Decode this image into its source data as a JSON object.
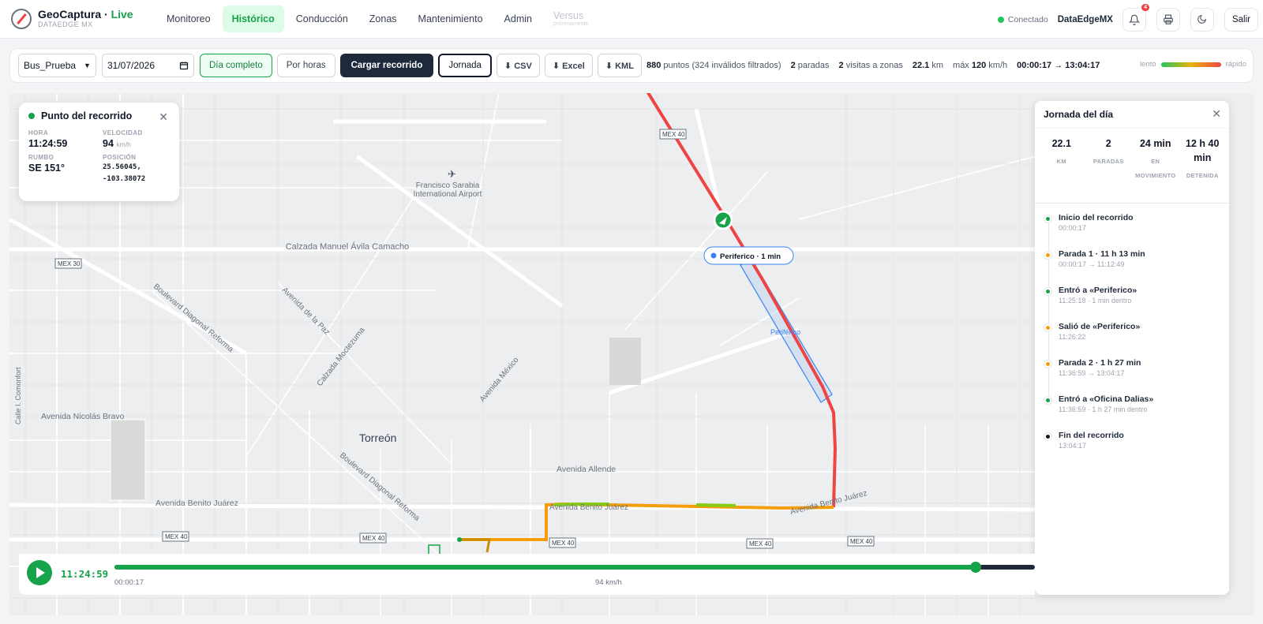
{
  "app": {
    "name": "GeoCaptura",
    "live": "Live",
    "sub": "DATAEDGE MX"
  },
  "nav": [
    {
      "label": "Monitoreo"
    },
    {
      "label": "Histórico"
    },
    {
      "label": "Conducción"
    },
    {
      "label": "Zonas"
    },
    {
      "label": "Mantenimiento"
    },
    {
      "label": "Admin"
    },
    {
      "label": "Versus",
      "sub": "próximamente"
    }
  ],
  "header": {
    "status": "Conectado",
    "org": "DataEdgeMX",
    "notifications": "4",
    "logout": "Salir",
    "icons": [
      "bell-icon",
      "printer-icon",
      "moon-icon"
    ]
  },
  "toolbar": {
    "vehicle": "Bus_Prueba",
    "date": "31/07/2026",
    "full_day": "Día completo",
    "by_hours": "Por horas",
    "load": "Cargar recorrido",
    "jornada": "Jornada",
    "csv": "⬇ CSV",
    "excel": "⬇ Excel",
    "kml": "⬇ KML",
    "points_num": "880",
    "points_text": "puntos (324 inválidos filtrados)",
    "stops_num": "2",
    "stops_text": "paradas",
    "visits_num": "2",
    "visits_text": "visitas a zonas",
    "km_num": "22.1",
    "km_text": "km",
    "max_text": "máx",
    "max_num": "120",
    "max_unit": "km/h",
    "range": "00:00:17 → 13:04:17",
    "legend_slow": "lento",
    "legend_fast": "rápido"
  },
  "map": {
    "labels": {
      "airport": "Francisco Sarabia",
      "airport2": "International Airport",
      "calzada": "Calzada Manuel Ávila Camacho",
      "diagonal": "Boulevard Diagonal Reforma",
      "diagonal2": "Boulevard Diagonal Reforma",
      "paz": "Avenida de la Paz",
      "moctezuma": "Calzada Moctezuma",
      "mexico": "Avenida México",
      "bravo": "Avenida Nicolás Bravo",
      "comonfort": "Calle I. Comonfort",
      "torreon": "Torreón",
      "allende": "Avenida Allende",
      "juarez": "Avenida Benito Juárez",
      "juarez2": "Avenida Benito Juárez",
      "juarez3": "Avenida Benito Juárez",
      "periferico": "Periférico",
      "mex40a": "MEX 40",
      "mex40b": "MEX 40",
      "mex40c": "MEX 40",
      "mex40d": "MEX 40",
      "mex40e": "MEX 40",
      "mex40f": "MEX 40",
      "mex30": "MEX 30"
    },
    "zone_tooltip": "Periferico · 1 min"
  },
  "point": {
    "title": "Punto del recorrido",
    "hora_label": "HORA",
    "hora": "11:24:59",
    "vel_label": "VELOCIDAD",
    "vel": "94",
    "vel_unit": "km/h",
    "rumbo_label": "RUMBO",
    "rumbo": "SE 151°",
    "pos_label": "POSICIÓN",
    "lat": "25.56045,",
    "lon": "-103.38072"
  },
  "jornada": {
    "title": "Jornada del día",
    "stats": [
      {
        "value": "22.1",
        "label": "KM"
      },
      {
        "value": "2",
        "label": "PARADAS"
      },
      {
        "value": "24 min",
        "label": "EN MOVIMIENTO"
      },
      {
        "value": "12 h 40 min",
        "label": "DETENIDA"
      }
    ],
    "events": [
      {
        "title": "Inicio del recorrido",
        "sub": "00:00:17",
        "color": "#16a34a"
      },
      {
        "title": "Parada 1 · 11 h 13 min",
        "sub": "00:00:17 → 11:12:49",
        "color": "#f59e0b"
      },
      {
        "title": "Entró a «Periferico»",
        "sub": "11:25:18 · 1 min dentro",
        "color": "#16a34a"
      },
      {
        "title": "Salió de «Periferico»",
        "sub": "11:26:22",
        "color": "#f59e0b"
      },
      {
        "title": "Parada 2 · 1 h 27 min",
        "sub": "11:36:59 → 13:04:17",
        "color": "#f59e0b"
      },
      {
        "title": "Entró a «Oficina Dalias»",
        "sub": "11:36:59 · 1 h 27 min dentro",
        "color": "#16a34a"
      },
      {
        "title": "Fin del recorrido",
        "sub": "13:04:17",
        "color": "#111827"
      }
    ]
  },
  "playback": {
    "time": "11:24:59",
    "start": "00:00:17",
    "speed": "94 km/h",
    "progress": 0.936
  },
  "colors": {
    "accent": "#16a34a",
    "route_fast": "#ef4444",
    "route_mid": "#eab308",
    "route_slow": "#22c55e",
    "zone": "#3b82f6"
  }
}
